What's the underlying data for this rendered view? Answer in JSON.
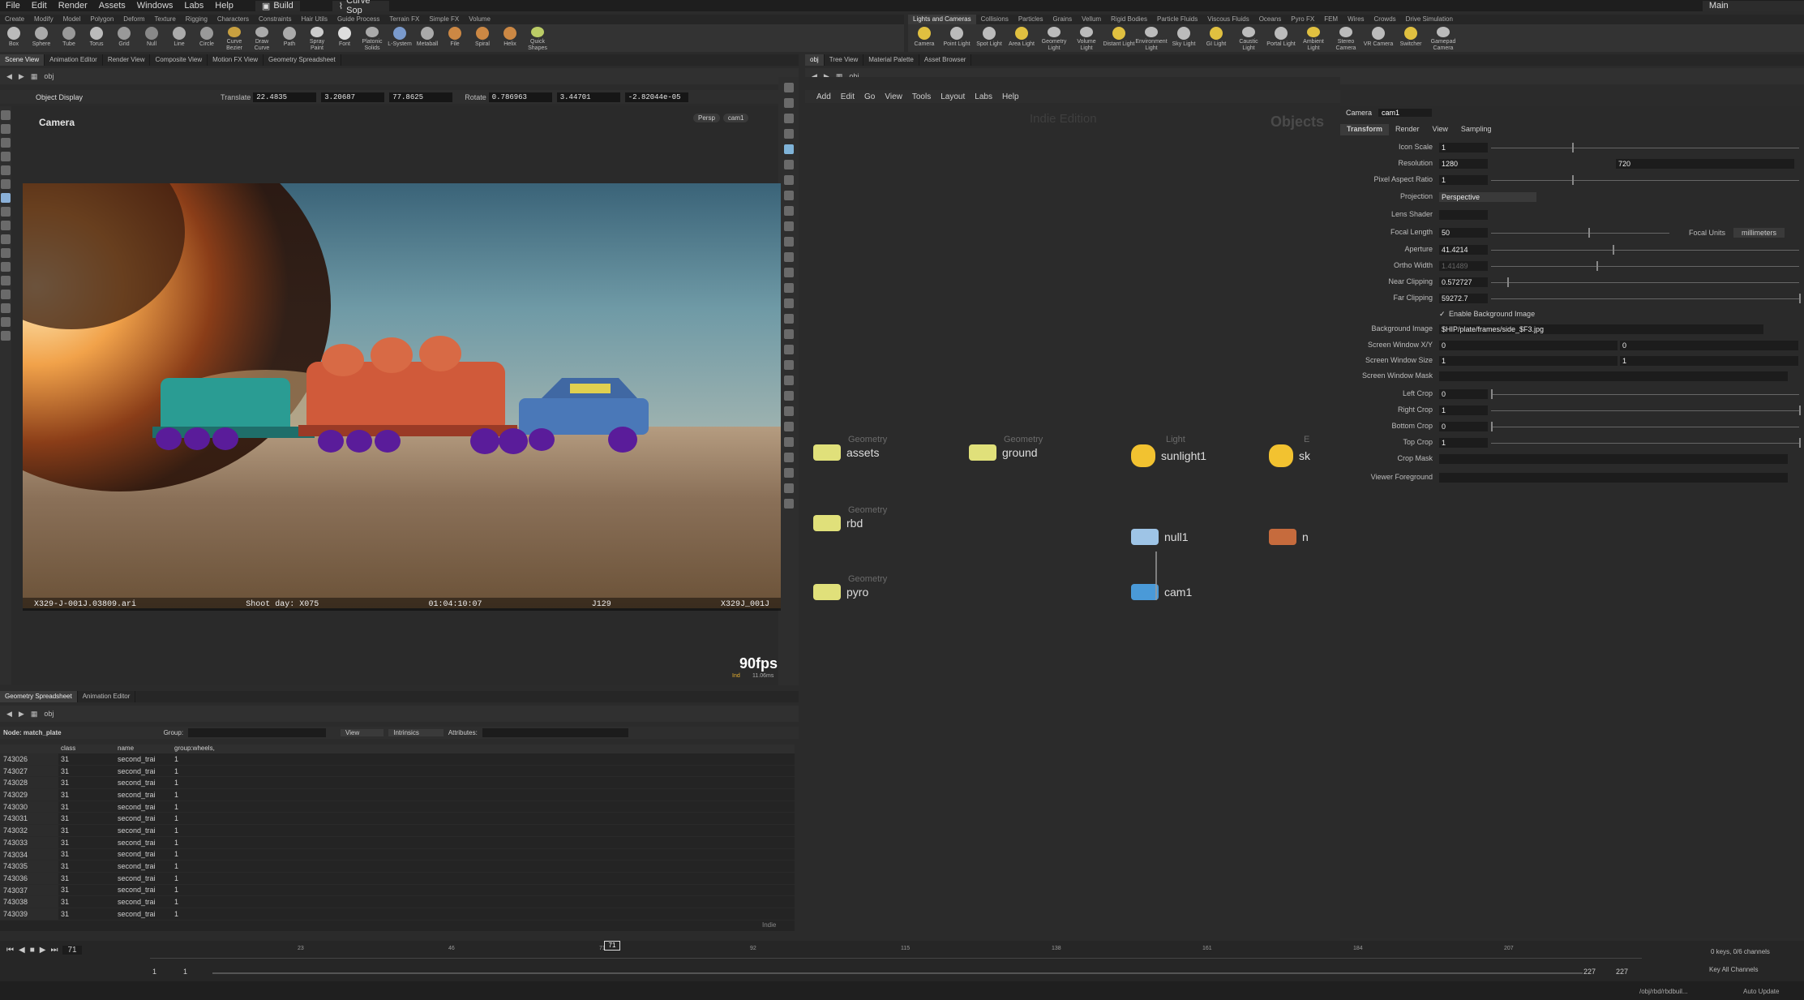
{
  "menubar": {
    "items": [
      "File",
      "Edit",
      "Render",
      "Assets",
      "Windows",
      "Labs",
      "Help"
    ],
    "desktop": "Build",
    "context": "Curve Sop",
    "workspace": "Main"
  },
  "shelf_tabs_left": [
    "Create",
    "Modify",
    "Model",
    "Polygon",
    "Deform",
    "Texture",
    "Rigging",
    "Characters",
    "Constraints",
    "Hair Utils",
    "Guide Process",
    "Terrain FX",
    "Simple FX",
    "Volume"
  ],
  "shelf_tools_left": [
    "Box",
    "Sphere",
    "Tube",
    "Torus",
    "Grid",
    "Null",
    "Line",
    "Circle",
    "Curve Bezier",
    "Draw Curve",
    "Path",
    "Spray Paint",
    "Font",
    "Platonic Solids",
    "L-System",
    "Metaball",
    "File",
    "Spiral",
    "Helix",
    "Quick Shapes"
  ],
  "shelf_tabs_right": [
    "Lights and Cameras",
    "Collisions",
    "Particles",
    "Grains",
    "Vellum",
    "Rigid Bodies",
    "Particle Fluids",
    "Viscous Fluids",
    "Oceans",
    "Pyro FX",
    "FEM",
    "Wires",
    "Crowds",
    "Drive Simulation"
  ],
  "shelf_tools_right": [
    "Camera",
    "Point Light",
    "Spot Light",
    "Area Light",
    "Geometry Light",
    "Volume Light",
    "Distant Light",
    "Environment Light",
    "Sky Light",
    "GI Light",
    "Caustic Light",
    "Portal Light",
    "Ambient Light",
    "Stereo Camera",
    "VR Camera",
    "Switcher",
    "Gamepad Camera"
  ],
  "left_pane_tabs": [
    "Scene View",
    "Animation Editor",
    "Render View",
    "Composite View",
    "Motion FX View",
    "Geometry Spreadsheet"
  ],
  "right_pane_tabs": [
    "obj",
    "Tree View",
    "Material Palette",
    "Asset Browser"
  ],
  "path": "obj",
  "viewport": {
    "object_display": "Object Display",
    "translate_label": "Translate",
    "translate": [
      "22.4835",
      "3.20687",
      "77.8625"
    ],
    "rotate_label": "Rotate",
    "rotate": [
      "0.786963",
      "3.44701",
      "-2.82044e-05"
    ],
    "camera_label": "Camera",
    "persp": "Persp",
    "cam": "cam1",
    "plate_info": [
      "X329-J-001J.03809.ari",
      "Shoot day: X075",
      "01:04:10:07",
      "J129",
      "X329J_001J"
    ],
    "fps": "90fps",
    "fps_sub_a": "Ind",
    "fps_sub_b": "11.06ms"
  },
  "bottom_tabs": [
    "Geometry Spreadsheet",
    "Animation Editor"
  ],
  "spreadsheet": {
    "node_label": "Node: match_plate",
    "group_label": "Group:",
    "view": "View",
    "intrinsics": "Intrinsics",
    "attributes": "Attributes:",
    "columns": [
      "",
      "class",
      "name",
      "group:wheels,"
    ],
    "rows": [
      [
        "743026",
        "31",
        "second_trai",
        "1"
      ],
      [
        "743027",
        "31",
        "second_trai",
        "1"
      ],
      [
        "743028",
        "31",
        "second_trai",
        "1"
      ],
      [
        "743029",
        "31",
        "second_trai",
        "1"
      ],
      [
        "743030",
        "31",
        "second_trai",
        "1"
      ],
      [
        "743031",
        "31",
        "second_trai",
        "1"
      ],
      [
        "743032",
        "31",
        "second_trai",
        "1"
      ],
      [
        "743033",
        "31",
        "second_trai",
        "1"
      ],
      [
        "743034",
        "31",
        "second_trai",
        "1"
      ],
      [
        "743035",
        "31",
        "second_trai",
        "1"
      ],
      [
        "743036",
        "31",
        "second_trai",
        "1"
      ],
      [
        "743037",
        "31",
        "second_trai",
        "1"
      ],
      [
        "743038",
        "31",
        "second_trai",
        "1"
      ],
      [
        "743039",
        "31",
        "second_trai",
        "1"
      ]
    ],
    "indie": "Indie"
  },
  "timeline": {
    "current_frame": "71",
    "ticks": [
      "23",
      "46",
      "71",
      "92",
      "115",
      "138",
      "161",
      "184",
      "207"
    ],
    "start": "1",
    "start2": "1",
    "end": "227",
    "end2": "227",
    "keys": "0 keys, 0/6 channels",
    "key_all": "Key All Channels",
    "path": "/obj/rbd/rbdbuil...",
    "auto_update": "Auto Update"
  },
  "network": {
    "menu": [
      "Add",
      "Edit",
      "Go",
      "View",
      "Tools",
      "Layout",
      "Labs",
      "Help"
    ],
    "watermark": "Indie Edition",
    "context": "Objects",
    "nodes": [
      {
        "type": "Geometry",
        "name": "assets",
        "color": "#e0e07a"
      },
      {
        "type": "Geometry",
        "name": "ground",
        "color": "#e0e07a"
      },
      {
        "type": "Light",
        "name": "sunlight1",
        "color": "#f2c230"
      },
      {
        "type": "Geometry",
        "name": "rbd",
        "color": "#e0e07a"
      },
      {
        "type": "Geometry",
        "name": "pyro",
        "color": "#e0e07a"
      },
      {
        "type": "",
        "name": "null1",
        "color": "#9ec4e6"
      },
      {
        "type": "",
        "name": "cam1",
        "color": "#4a9ad8"
      },
      {
        "type": "E",
        "name": "sk",
        "color": "#f2c230"
      },
      {
        "type": "",
        "name": "n",
        "color": "#c66b3d"
      }
    ]
  },
  "params": {
    "node_type": "Camera",
    "node_name": "cam1",
    "tabs": [
      "Transform",
      "Render",
      "View",
      "Sampling"
    ],
    "rows": [
      {
        "label": "Icon Scale",
        "value": "1"
      },
      {
        "label": "Resolution",
        "value": "1280",
        "value2": "720"
      },
      {
        "label": "Pixel Aspect Ratio",
        "value": "1"
      },
      {
        "label": "Projection",
        "value": "Perspective"
      },
      {
        "label": "Lens Shader",
        "value": ""
      },
      {
        "label": "Focal Length",
        "value": "50",
        "extra_label": "Focal Units",
        "extra_value": "millimeters"
      },
      {
        "label": "Aperture",
        "value": "41.4214"
      },
      {
        "label": "Ortho Width",
        "value": "1.41489"
      },
      {
        "label": "Near Clipping",
        "value": "0.572727"
      },
      {
        "label": "Far Clipping",
        "value": "59272.7"
      },
      {
        "label": "",
        "value": "Enable Background Image"
      },
      {
        "label": "Background Image",
        "value": "$HIP/plate/frames/side_$F3.jpg"
      },
      {
        "label": "Screen Window X/Y",
        "value": "0",
        "value2": "0"
      },
      {
        "label": "Screen Window Size",
        "value": "1",
        "value2": "1"
      },
      {
        "label": "Screen Window Mask",
        "value": ""
      },
      {
        "label": "Left Crop",
        "value": "0"
      },
      {
        "label": "Right Crop",
        "value": "1"
      },
      {
        "label": "Bottom Crop",
        "value": "0"
      },
      {
        "label": "Top Crop",
        "value": "1"
      },
      {
        "label": "Crop Mask",
        "value": ""
      },
      {
        "label": "Viewer Foreground",
        "value": ""
      }
    ]
  }
}
